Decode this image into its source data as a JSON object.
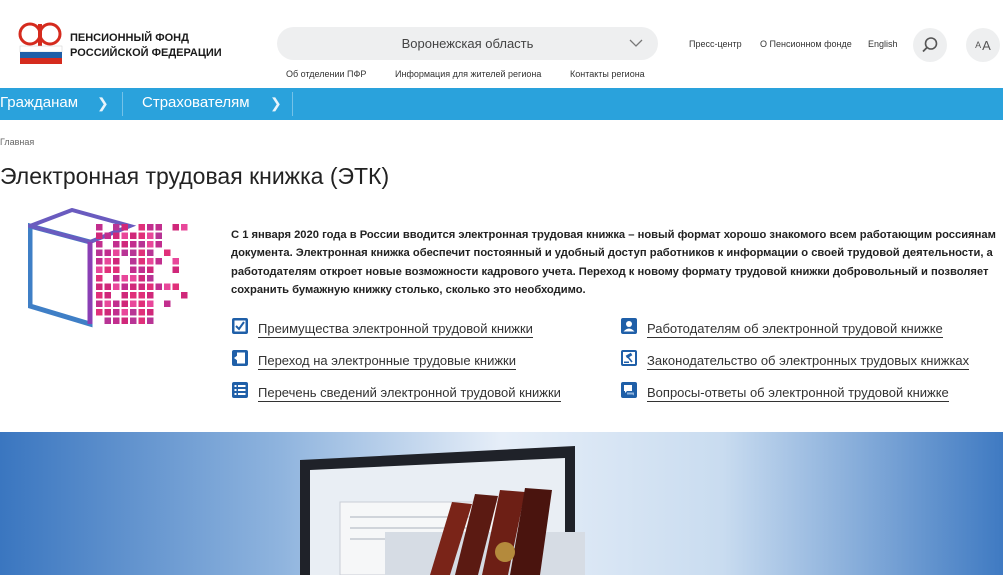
{
  "logo": {
    "line1": "ПЕНСИОННЫЙ ФОНД",
    "line2": "РОССИЙСКОЙ ФЕДЕРАЦИИ"
  },
  "region": {
    "label": "Воронежская область"
  },
  "subnav": [
    "Об отделении ПФР",
    "Информация для жителей региона",
    "Контакты региона"
  ],
  "topnav": [
    "Пресс-центр",
    "О Пенсионном фонде",
    "English"
  ],
  "font_size": {
    "small": "A",
    "large": "A"
  },
  "bluenav": [
    "Гражданам",
    "Страхователям"
  ],
  "breadcrumb": "Главная",
  "title": "Электронная трудовая книжка (ЭТК)",
  "intro": "С 1 января 2020 года в России вводится электронная трудовая книжка – новый формат хорошо знакомого всем работающим россиянам документа. Электронная книжка обеспечит постоянный и удобный доступ работников к информации о своей трудовой деятельности, а работодателям откроет новые возможности кадрового учета. Переход к новому формату трудовой книжки добровольный и позволяет сохранить бумажную книжку столько, сколько это необходимо.",
  "links": [
    {
      "label": "Преимущества электронной трудовой книжки",
      "icon": "checkbox-icon"
    },
    {
      "label": "Переход на электронные трудовые книжки",
      "icon": "exit-door-icon"
    },
    {
      "label": "Перечень сведений электронной трудовой книжки",
      "icon": "list-icon"
    },
    {
      "label": "Работодателям об электронной трудовой книжке",
      "icon": "person-card-icon"
    },
    {
      "label": "Законодательство об электронных трудовых книжках",
      "icon": "gavel-icon"
    },
    {
      "label": "Вопросы-ответы об электронной трудовой книжке",
      "icon": "question-chat-icon"
    }
  ],
  "colors": {
    "accent": "#2aa2dc",
    "link_icon": "#1f5fa8",
    "brand_red": "#d52b1e"
  }
}
